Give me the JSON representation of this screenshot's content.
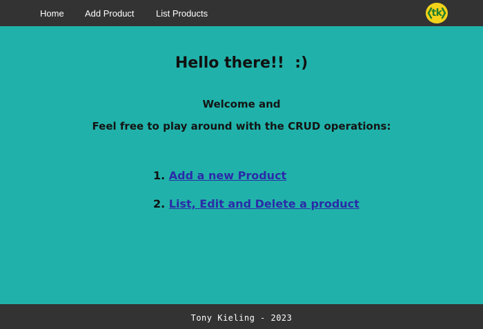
{
  "navbar": {
    "items": [
      {
        "label": "Home"
      },
      {
        "label": "Add Product"
      },
      {
        "label": "List Products"
      }
    ],
    "logo_text": "tk",
    "logo_color": "#f3d21a"
  },
  "main": {
    "heading": "Hello there!!  :)",
    "subheading_line1": "Welcome and",
    "subheading_line2": "Feel free to play around with the CRUD operations:",
    "links": [
      {
        "number": "1.",
        "label": "Add a new Product"
      },
      {
        "number": "2.",
        "label": "List, Edit and Delete a product"
      }
    ]
  },
  "footer": {
    "text": "Tony Kieling - 2023"
  },
  "colors": {
    "background": "#20b2aa",
    "navbar": "#333333",
    "link": "#2b2ba8"
  }
}
